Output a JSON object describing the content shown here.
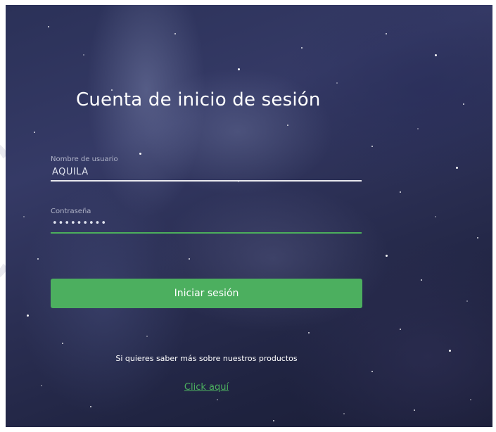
{
  "login": {
    "title": "Cuenta de inicio de sesión",
    "username": {
      "label": "Nombre de usuario",
      "value": "AQUILA"
    },
    "password": {
      "label": "Contraseña",
      "value": "•••••••••"
    },
    "submit_label": "Iniciar sesión",
    "info_text": "Si quieres saber más sobre nuestros productos",
    "link_text": "Click aquí"
  },
  "colors": {
    "accent": "#4caf5f",
    "background": "#2b3158",
    "text": "#ffffff"
  }
}
